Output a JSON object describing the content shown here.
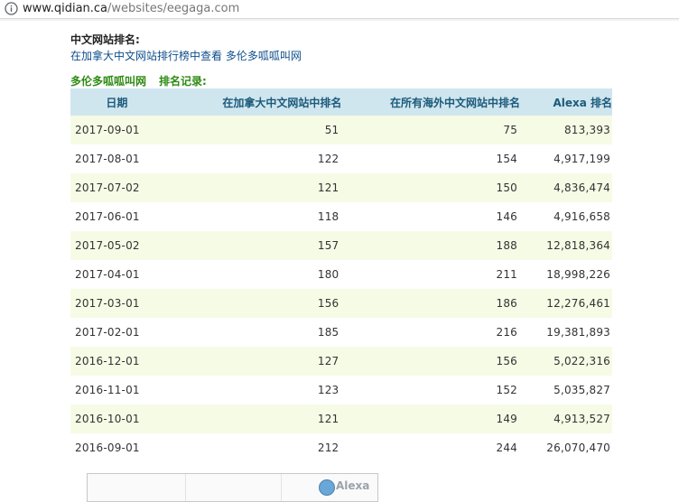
{
  "browser": {
    "url_domain": "www.qidian.ca",
    "url_path": "/websites/eegaga.com"
  },
  "ranking": {
    "title": "中文网站排名:",
    "link_prefix": "在加拿大中文网站排行榜中查看",
    "site_name": "多伦多呱呱叫网"
  },
  "records": {
    "site_name": "多伦多呱呱叫网",
    "label": "排名记录:"
  },
  "table": {
    "headers": [
      "日期",
      "在加拿大中文网站中排名",
      "在所有海外中文网站中排名",
      "Alexa 排名"
    ],
    "rows": [
      [
        "2017-09-01",
        "51",
        "75",
        "813,393"
      ],
      [
        "2017-08-01",
        "122",
        "154",
        "4,917,199"
      ],
      [
        "2017-07-02",
        "121",
        "150",
        "4,836,474"
      ],
      [
        "2017-06-01",
        "118",
        "146",
        "4,916,658"
      ],
      [
        "2017-05-02",
        "157",
        "188",
        "12,818,364"
      ],
      [
        "2017-04-01",
        "180",
        "211",
        "18,998,226"
      ],
      [
        "2017-03-01",
        "156",
        "186",
        "12,276,461"
      ],
      [
        "2017-02-01",
        "185",
        "216",
        "19,381,893"
      ],
      [
        "2016-12-01",
        "127",
        "156",
        "5,022,316"
      ],
      [
        "2016-11-01",
        "123",
        "152",
        "5,035,827"
      ],
      [
        "2016-10-01",
        "121",
        "149",
        "4,913,527"
      ],
      [
        "2016-09-01",
        "212",
        "244",
        "26,070,470"
      ]
    ]
  },
  "widget": {
    "brand": "Alexa"
  },
  "colors": {
    "header_bg": "#cfe6ef",
    "header_text": "#1c5a7a",
    "odd_row_bg": "#f6fbe6",
    "link": "#0e4d8c",
    "green_heading": "#2e8b12"
  }
}
